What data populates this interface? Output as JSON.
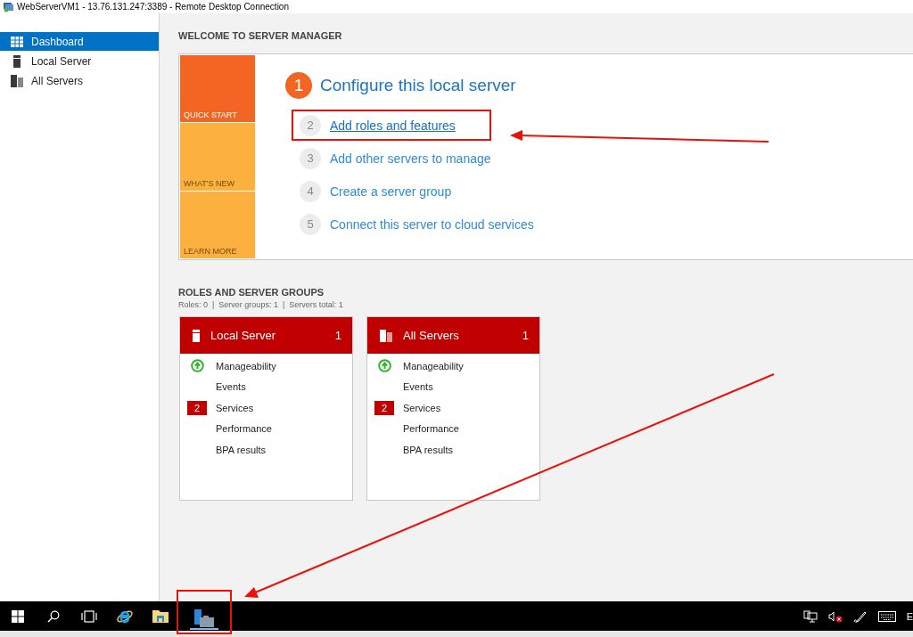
{
  "window": {
    "title": "WebServerVM1 - 13.76.131.247:3389 - Remote Desktop Connection"
  },
  "sidebar": {
    "items": [
      {
        "label": "Dashboard",
        "kind": "dashboard",
        "selected": true
      },
      {
        "label": "Local Server",
        "kind": "server",
        "selected": false
      },
      {
        "label": "All Servers",
        "kind": "servers",
        "selected": false
      }
    ]
  },
  "welcome": {
    "title": "WELCOME TO SERVER MANAGER",
    "tiles": [
      {
        "label": "QUICK START",
        "color": "#f26522"
      },
      {
        "label": "WHAT'S NEW",
        "color": "#fbb040"
      },
      {
        "label": "LEARN MORE",
        "color": "#fbb040"
      }
    ],
    "heading": {
      "number": "1",
      "text": "Configure this local server"
    },
    "steps": [
      {
        "number": "2",
        "label": "Add roles and features",
        "hovered": true,
        "highlighted": true
      },
      {
        "number": "3",
        "label": "Add other servers to manage",
        "hovered": false,
        "highlighted": false
      },
      {
        "number": "4",
        "label": "Create a server group",
        "hovered": false,
        "highlighted": false
      },
      {
        "number": "5",
        "label": "Connect this server to cloud services",
        "hovered": false,
        "highlighted": false
      }
    ]
  },
  "roles": {
    "title": "ROLES AND SERVER GROUPS",
    "summary": "Roles: 0  |  Server groups: 1  |  Servers total: 1",
    "tiles": [
      {
        "title": "Local Server",
        "count": "1",
        "kind": "server",
        "rows": [
          {
            "label": "Manageability",
            "healthy": true
          },
          {
            "label": "Events",
            "healthy": false
          },
          {
            "label": "Services",
            "healthy": false,
            "badge": "2"
          },
          {
            "label": "Performance",
            "healthy": false
          },
          {
            "label": "BPA results",
            "healthy": false
          }
        ]
      },
      {
        "title": "All Servers",
        "count": "1",
        "kind": "servers",
        "rows": [
          {
            "label": "Manageability",
            "healthy": true
          },
          {
            "label": "Events",
            "healthy": false
          },
          {
            "label": "Services",
            "healthy": false,
            "badge": "2"
          },
          {
            "label": "Performance",
            "healthy": false
          },
          {
            "label": "BPA results",
            "healthy": false
          }
        ]
      }
    ]
  },
  "taskbar": {
    "apps": [
      {
        "kind": "start",
        "active": false,
        "highlighted": false
      },
      {
        "kind": "search",
        "active": false,
        "highlighted": false
      },
      {
        "kind": "task-view",
        "active": false,
        "highlighted": false
      },
      {
        "kind": "browser",
        "active": false,
        "highlighted": false
      },
      {
        "kind": "folder",
        "active": false,
        "highlighted": false
      },
      {
        "kind": "server-manager",
        "active": true,
        "highlighted": true
      }
    ],
    "tray": [
      {
        "kind": "network"
      },
      {
        "kind": "volume-muted"
      },
      {
        "kind": "pen"
      },
      {
        "kind": "keyboard"
      }
    ],
    "language": "E"
  }
}
